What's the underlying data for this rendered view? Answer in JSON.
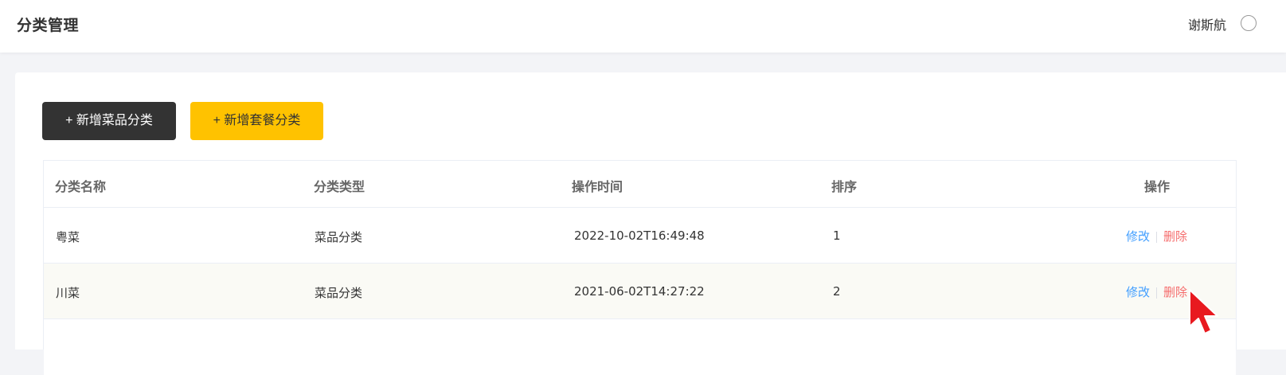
{
  "header": {
    "title": "分类管理",
    "user_name": "谢斯航"
  },
  "toolbar": {
    "add_dish_category_label": "+ 新增菜品分类",
    "add_combo_category_label": "+ 新增套餐分类"
  },
  "table": {
    "columns": [
      "分类名称",
      "分类类型",
      "操作时间",
      "排序",
      "操作"
    ],
    "rows": [
      {
        "name": "粤菜",
        "type": "菜品分类",
        "time": "2022-10-02T16:49:48",
        "sort": "1",
        "edit": "修改",
        "delete": "删除"
      },
      {
        "name": "川菜",
        "type": "菜品分类",
        "time": "2021-06-02T14:27:22",
        "sort": "2",
        "edit": "修改",
        "delete": "删除"
      }
    ]
  },
  "colors": {
    "primary_dark": "#333333",
    "accent_yellow": "#ffc200",
    "edit_link": "#419eff",
    "delete_link": "#f56c6c",
    "hover_row": "#fafaf5"
  },
  "icons": {
    "user": "user-circle-icon",
    "cursor": "mouse-pointer-icon"
  }
}
